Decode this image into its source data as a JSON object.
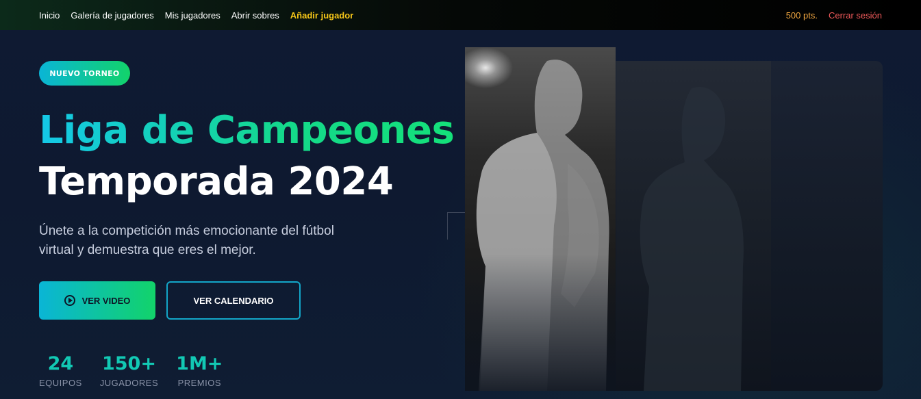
{
  "nav": {
    "links": [
      "Inicio",
      "Galería de jugadores",
      "Mis jugadores",
      "Abrir sobres"
    ],
    "highlight_link": "Añadir jugador",
    "points": "500 pts.",
    "logout": "Cerrar sesión"
  },
  "hero": {
    "badge": "NUEVO TORNEO",
    "title_line1": "Liga de Campeones",
    "title_line2": "Temporada 2024",
    "description": "Únete a la competición más emocionante del fútbol virtual y demuestra que eres el mejor.",
    "btn_video": "VER VIDEO",
    "btn_calendar": "VER CALENDARIO"
  },
  "stats": [
    {
      "value": "24",
      "label": "EQUIPOS"
    },
    {
      "value": "150+",
      "label": "JUGADORES"
    },
    {
      "value": "1M+",
      "label": "PREMIOS"
    }
  ],
  "colors": {
    "accent_cyan": "#0ab5d6",
    "accent_green": "#12d36a",
    "highlight_yellow": "#f5c518",
    "logout_red": "#f05a5a"
  }
}
